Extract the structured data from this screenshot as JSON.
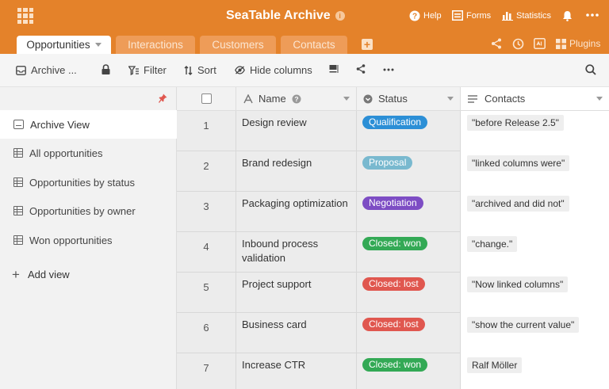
{
  "header": {
    "title": "SeaTable Archive",
    "help_label": "Help",
    "forms_label": "Forms",
    "statistics_label": "Statistics"
  },
  "tabs": {
    "items": [
      {
        "label": "Opportunities"
      },
      {
        "label": "Interactions"
      },
      {
        "label": "Customers"
      },
      {
        "label": "Contacts"
      }
    ],
    "plugins_label": "Plugins"
  },
  "toolbar": {
    "view_label": "Archive ...",
    "filter_label": "Filter",
    "sort_label": "Sort",
    "hide_columns_label": "Hide columns"
  },
  "sidebar": {
    "views": [
      {
        "label": "Archive View"
      },
      {
        "label": "All opportunities"
      },
      {
        "label": "Opportunities by status"
      },
      {
        "label": "Opportunities by owner"
      },
      {
        "label": "Won opportunities"
      }
    ],
    "add_view_label": "Add view"
  },
  "grid": {
    "columns": {
      "name": "Name",
      "status": "Status",
      "contacts": "Contacts"
    },
    "rows": [
      {
        "num": "1",
        "name": "Design review",
        "status": "Qualification",
        "status_color": "#2c8fd6",
        "contact": "\"before Release 2.5\""
      },
      {
        "num": "2",
        "name": "Brand redesign",
        "status": "Proposal",
        "status_color": "#79b9cf",
        "contact": "\"linked columns were\""
      },
      {
        "num": "3",
        "name": "Packaging optimization",
        "status": "Negotiation",
        "status_color": "#7d4dc4",
        "contact": "\"archived and did not\""
      },
      {
        "num": "4",
        "name": "Inbound process validation",
        "status": "Closed: won",
        "status_color": "#33a955",
        "contact": "\"change.\""
      },
      {
        "num": "5",
        "name": "Project support",
        "status": "Closed: lost",
        "status_color": "#e0574f",
        "contact": "\"Now linked columns\""
      },
      {
        "num": "6",
        "name": "Business card",
        "status": "Closed: lost",
        "status_color": "#e0574f",
        "contact": "\"show the current value\""
      },
      {
        "num": "7",
        "name": "Increase CTR",
        "status": "Closed: won",
        "status_color": "#33a955",
        "contact": "Ralf Möller"
      }
    ]
  },
  "colors": {
    "accent": "#e4822a"
  }
}
